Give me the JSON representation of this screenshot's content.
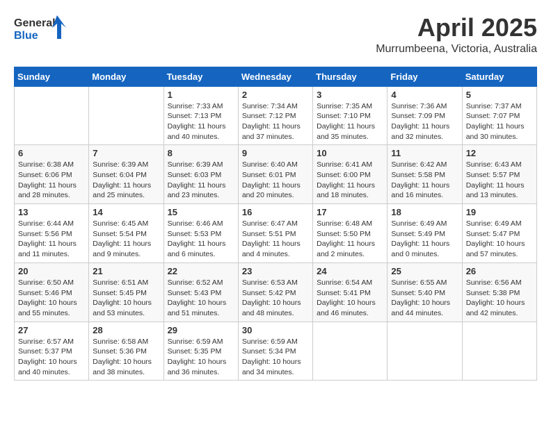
{
  "header": {
    "logo_line1": "General",
    "logo_line2": "Blue",
    "month": "April 2025",
    "location": "Murrumbeena, Victoria, Australia"
  },
  "weekdays": [
    "Sunday",
    "Monday",
    "Tuesday",
    "Wednesday",
    "Thursday",
    "Friday",
    "Saturday"
  ],
  "weeks": [
    [
      {
        "day": "",
        "info": ""
      },
      {
        "day": "",
        "info": ""
      },
      {
        "day": "1",
        "info": "Sunrise: 7:33 AM\nSunset: 7:13 PM\nDaylight: 11 hours and 40 minutes."
      },
      {
        "day": "2",
        "info": "Sunrise: 7:34 AM\nSunset: 7:12 PM\nDaylight: 11 hours and 37 minutes."
      },
      {
        "day": "3",
        "info": "Sunrise: 7:35 AM\nSunset: 7:10 PM\nDaylight: 11 hours and 35 minutes."
      },
      {
        "day": "4",
        "info": "Sunrise: 7:36 AM\nSunset: 7:09 PM\nDaylight: 11 hours and 32 minutes."
      },
      {
        "day": "5",
        "info": "Sunrise: 7:37 AM\nSunset: 7:07 PM\nDaylight: 11 hours and 30 minutes."
      }
    ],
    [
      {
        "day": "6",
        "info": "Sunrise: 6:38 AM\nSunset: 6:06 PM\nDaylight: 11 hours and 28 minutes."
      },
      {
        "day": "7",
        "info": "Sunrise: 6:39 AM\nSunset: 6:04 PM\nDaylight: 11 hours and 25 minutes."
      },
      {
        "day": "8",
        "info": "Sunrise: 6:39 AM\nSunset: 6:03 PM\nDaylight: 11 hours and 23 minutes."
      },
      {
        "day": "9",
        "info": "Sunrise: 6:40 AM\nSunset: 6:01 PM\nDaylight: 11 hours and 20 minutes."
      },
      {
        "day": "10",
        "info": "Sunrise: 6:41 AM\nSunset: 6:00 PM\nDaylight: 11 hours and 18 minutes."
      },
      {
        "day": "11",
        "info": "Sunrise: 6:42 AM\nSunset: 5:58 PM\nDaylight: 11 hours and 16 minutes."
      },
      {
        "day": "12",
        "info": "Sunrise: 6:43 AM\nSunset: 5:57 PM\nDaylight: 11 hours and 13 minutes."
      }
    ],
    [
      {
        "day": "13",
        "info": "Sunrise: 6:44 AM\nSunset: 5:56 PM\nDaylight: 11 hours and 11 minutes."
      },
      {
        "day": "14",
        "info": "Sunrise: 6:45 AM\nSunset: 5:54 PM\nDaylight: 11 hours and 9 minutes."
      },
      {
        "day": "15",
        "info": "Sunrise: 6:46 AM\nSunset: 5:53 PM\nDaylight: 11 hours and 6 minutes."
      },
      {
        "day": "16",
        "info": "Sunrise: 6:47 AM\nSunset: 5:51 PM\nDaylight: 11 hours and 4 minutes."
      },
      {
        "day": "17",
        "info": "Sunrise: 6:48 AM\nSunset: 5:50 PM\nDaylight: 11 hours and 2 minutes."
      },
      {
        "day": "18",
        "info": "Sunrise: 6:49 AM\nSunset: 5:49 PM\nDaylight: 11 hours and 0 minutes."
      },
      {
        "day": "19",
        "info": "Sunrise: 6:49 AM\nSunset: 5:47 PM\nDaylight: 10 hours and 57 minutes."
      }
    ],
    [
      {
        "day": "20",
        "info": "Sunrise: 6:50 AM\nSunset: 5:46 PM\nDaylight: 10 hours and 55 minutes."
      },
      {
        "day": "21",
        "info": "Sunrise: 6:51 AM\nSunset: 5:45 PM\nDaylight: 10 hours and 53 minutes."
      },
      {
        "day": "22",
        "info": "Sunrise: 6:52 AM\nSunset: 5:43 PM\nDaylight: 10 hours and 51 minutes."
      },
      {
        "day": "23",
        "info": "Sunrise: 6:53 AM\nSunset: 5:42 PM\nDaylight: 10 hours and 48 minutes."
      },
      {
        "day": "24",
        "info": "Sunrise: 6:54 AM\nSunset: 5:41 PM\nDaylight: 10 hours and 46 minutes."
      },
      {
        "day": "25",
        "info": "Sunrise: 6:55 AM\nSunset: 5:40 PM\nDaylight: 10 hours and 44 minutes."
      },
      {
        "day": "26",
        "info": "Sunrise: 6:56 AM\nSunset: 5:38 PM\nDaylight: 10 hours and 42 minutes."
      }
    ],
    [
      {
        "day": "27",
        "info": "Sunrise: 6:57 AM\nSunset: 5:37 PM\nDaylight: 10 hours and 40 minutes."
      },
      {
        "day": "28",
        "info": "Sunrise: 6:58 AM\nSunset: 5:36 PM\nDaylight: 10 hours and 38 minutes."
      },
      {
        "day": "29",
        "info": "Sunrise: 6:59 AM\nSunset: 5:35 PM\nDaylight: 10 hours and 36 minutes."
      },
      {
        "day": "30",
        "info": "Sunrise: 6:59 AM\nSunset: 5:34 PM\nDaylight: 10 hours and 34 minutes."
      },
      {
        "day": "",
        "info": ""
      },
      {
        "day": "",
        "info": ""
      },
      {
        "day": "",
        "info": ""
      }
    ]
  ]
}
